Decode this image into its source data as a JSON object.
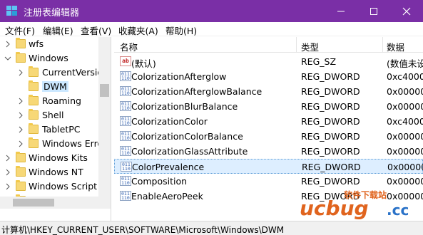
{
  "window": {
    "title": "注册表编辑器",
    "title_bar_color": "#7a2fa6"
  },
  "menu": [
    {
      "label": "文件(F)"
    },
    {
      "label": "编辑(E)"
    },
    {
      "label": "查看(V)"
    },
    {
      "label": "收藏夹(A)"
    },
    {
      "label": "帮助(H)"
    }
  ],
  "tree": {
    "items": [
      {
        "label": "wfs",
        "expander": "collapsed"
      },
      {
        "label": "Windows",
        "expander": "expanded"
      },
      {
        "label": "CurrentVersio",
        "expander": "collapsed"
      },
      {
        "label": "DWM",
        "expander": "none",
        "selected": true
      },
      {
        "label": "Roaming",
        "expander": "collapsed"
      },
      {
        "label": "Shell",
        "expander": "collapsed"
      },
      {
        "label": "TabletPC",
        "expander": "collapsed"
      },
      {
        "label": "Windows Erro",
        "expander": "collapsed"
      },
      {
        "label": "Windows Kits",
        "expander": "collapsed"
      },
      {
        "label": "Windows NT",
        "expander": "collapsed"
      },
      {
        "label": "Windows Script",
        "expander": "collapsed"
      },
      {
        "label": "Windows Script",
        "expander": "collapsed"
      }
    ]
  },
  "list": {
    "columns": [
      "名称",
      "类型",
      "数据"
    ],
    "rows": [
      {
        "name": "(默认)",
        "type": "REG_SZ",
        "data": "(数值未设",
        "icon": "string-value-icon"
      },
      {
        "name": "ColorizationAfterglow",
        "type": "REG_DWORD",
        "data": "0xc4000",
        "icon": "binary-value-icon"
      },
      {
        "name": "ColorizationAfterglowBalance",
        "type": "REG_DWORD",
        "data": "0x00000",
        "icon": "binary-value-icon"
      },
      {
        "name": "ColorizationBlurBalance",
        "type": "REG_DWORD",
        "data": "0x00000",
        "icon": "binary-value-icon"
      },
      {
        "name": "ColorizationColor",
        "type": "REG_DWORD",
        "data": "0xc4000",
        "icon": "binary-value-icon"
      },
      {
        "name": "ColorizationColorBalance",
        "type": "REG_DWORD",
        "data": "0x00000",
        "icon": "binary-value-icon"
      },
      {
        "name": "ColorizationGlassAttribute",
        "type": "REG_DWORD",
        "data": "0x00000",
        "icon": "binary-value-icon"
      },
      {
        "name": "ColorPrevalence",
        "type": "REG_DWORD",
        "data": "0x00000",
        "icon": "binary-value-icon",
        "selected": true
      },
      {
        "name": "Composition",
        "type": "REG_DWORD",
        "data": "0x00000",
        "icon": "binary-value-icon"
      },
      {
        "name": "EnableAeroPeek",
        "type": "REG_DWORD",
        "data": "0x00000",
        "icon": "binary-value-icon"
      }
    ]
  },
  "status": {
    "path": "计算机\\HKEY_CURRENT_USER\\SOFTWARE\\Microsoft\\Windows\\DWM"
  },
  "watermark": {
    "site_cn": "软件下载站",
    "brand": "ucbug",
    "tld": ".cc"
  }
}
